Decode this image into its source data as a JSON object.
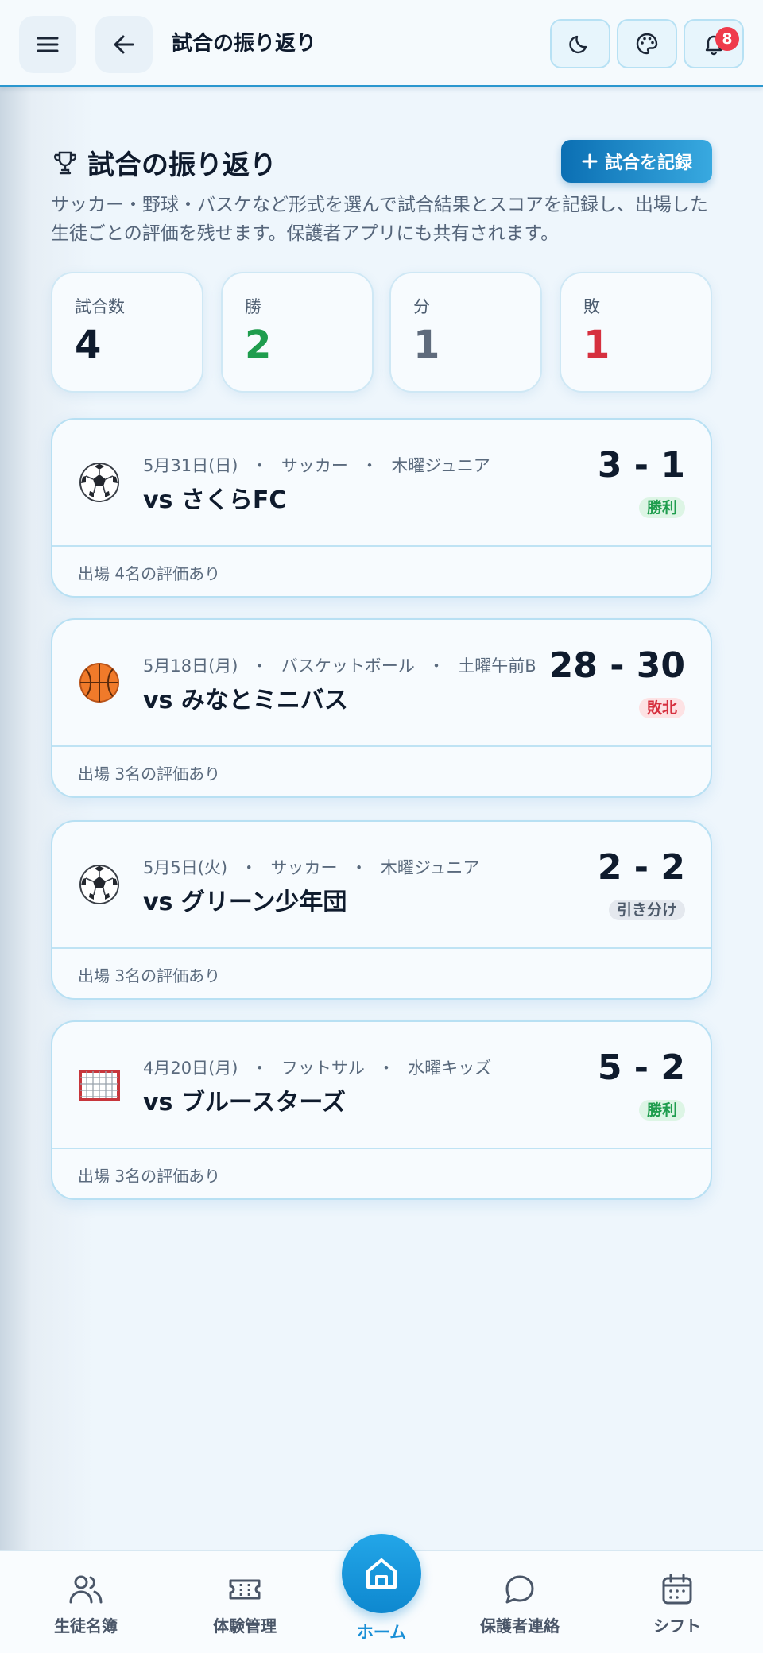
{
  "header": {
    "title": "試合の振り返り",
    "notification_count": "8",
    "icons": [
      "menu-icon",
      "back-arrow-icon",
      "moon-icon",
      "palette-icon",
      "bell-icon"
    ]
  },
  "page": {
    "title": "試合の振り返り",
    "record_button": "試合を記録",
    "description": "サッカー・野球・バスケなど形式を選んで試合結果とスコアを記録し、出場した生徒ごとの評価を残せます。保護者アプリにも共有されます。"
  },
  "stats": [
    {
      "label": "試合数",
      "value": "4",
      "color": "#0f1b2d"
    },
    {
      "label": "勝",
      "value": "2",
      "color": "#1f9d4e"
    },
    {
      "label": "分",
      "value": "1",
      "color": "#5f6b7c"
    },
    {
      "label": "敗",
      "value": "1",
      "color": "#d6303f"
    }
  ],
  "matches": [
    {
      "icon": "soccer-ball-icon",
      "date": "5月31日(日)",
      "sport": "サッカー",
      "team": "木曜ジュニア",
      "opponent": "vs さくらFC",
      "score": "3 - 1",
      "result": "勝利",
      "result_type": "win",
      "footer": "出場 4名の評価あり"
    },
    {
      "icon": "basketball-icon",
      "date": "5月18日(月)",
      "sport": "バスケットボール",
      "team": "土曜午前B",
      "opponent": "vs みなとミニバス",
      "score": "28 - 30",
      "result": "敗北",
      "result_type": "loss",
      "footer": "出場 3名の評価あり"
    },
    {
      "icon": "soccer-ball-icon",
      "date": "5月5日(火)",
      "sport": "サッカー",
      "team": "木曜ジュニア",
      "opponent": "vs グリーン少年団",
      "score": "2 - 2",
      "result": "引き分け",
      "result_type": "draw",
      "footer": "出場 3名の評価あり"
    },
    {
      "icon": "goal-net-icon",
      "date": "4月20日(月)",
      "sport": "フットサル",
      "team": "水曜キッズ",
      "opponent": "vs ブルースターズ",
      "score": "5 - 2",
      "result": "勝利",
      "result_type": "win",
      "footer": "出場 3名の評価あり"
    }
  ],
  "meta_separator": "・",
  "bottom_nav": {
    "items": [
      {
        "label": "生徒名簿",
        "icon": "students-icon"
      },
      {
        "label": "体験管理",
        "icon": "ticket-icon"
      },
      {
        "label": "ホーム",
        "icon": "home-icon",
        "active": true
      },
      {
        "label": "保護者連絡",
        "icon": "chat-bubble-icon"
      },
      {
        "label": "シフト",
        "icon": "calendar-icon"
      }
    ]
  }
}
